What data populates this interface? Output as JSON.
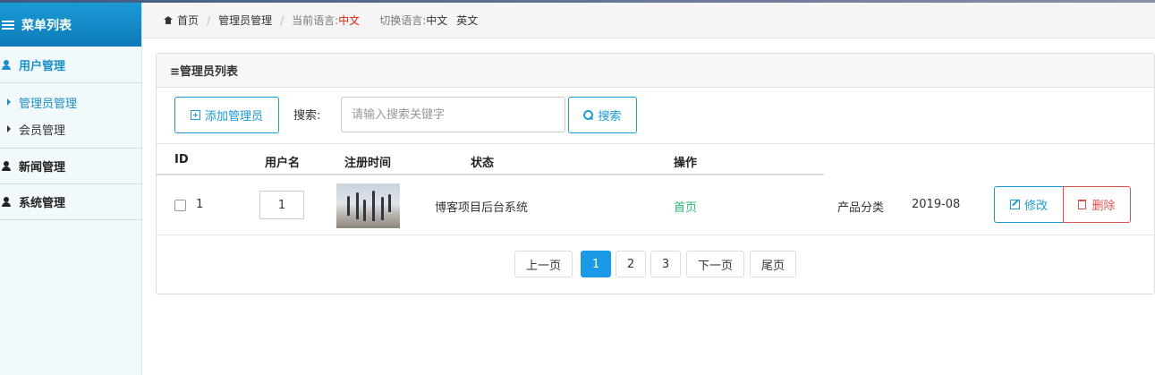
{
  "sidebar": {
    "title": "菜单列表",
    "sections": [
      {
        "label": "用户管理",
        "items": [
          {
            "label": "管理员管理"
          },
          {
            "label": "会员管理"
          }
        ]
      },
      {
        "label": "新闻管理"
      },
      {
        "label": "系统管理"
      }
    ]
  },
  "breadcrumb": {
    "home": "首页",
    "current": "管理员管理",
    "lang_label": "当前语言:",
    "lang_value": "中文",
    "switch_label": "切换语言:",
    "switch_options": [
      "中文",
      "英文"
    ]
  },
  "panel": {
    "title": "≡管理员列表",
    "add_button": "添加管理员",
    "search_label": "搜索:",
    "search_placeholder": "请输入搜索关键字",
    "search_button": "搜索"
  },
  "table": {
    "columns": [
      "ID",
      "用户名",
      "注册时间",
      "状态",
      "操作"
    ],
    "rows": [
      {
        "id": "1",
        "sort": "1",
        "title": "博客项目后台系统",
        "link": "首页",
        "category": "产品分类",
        "date": "2019-08",
        "edit": "修改",
        "delete": "删除"
      }
    ]
  },
  "pagination": {
    "prev": "上一页",
    "pages": [
      "1",
      "2",
      "3"
    ],
    "current": "1",
    "next": "下一页",
    "last": "尾页"
  },
  "colors": {
    "accent": "#1a9ad6",
    "danger": "#d9534f",
    "link_green": "#2bb673",
    "lang_red": "#d9230f"
  }
}
